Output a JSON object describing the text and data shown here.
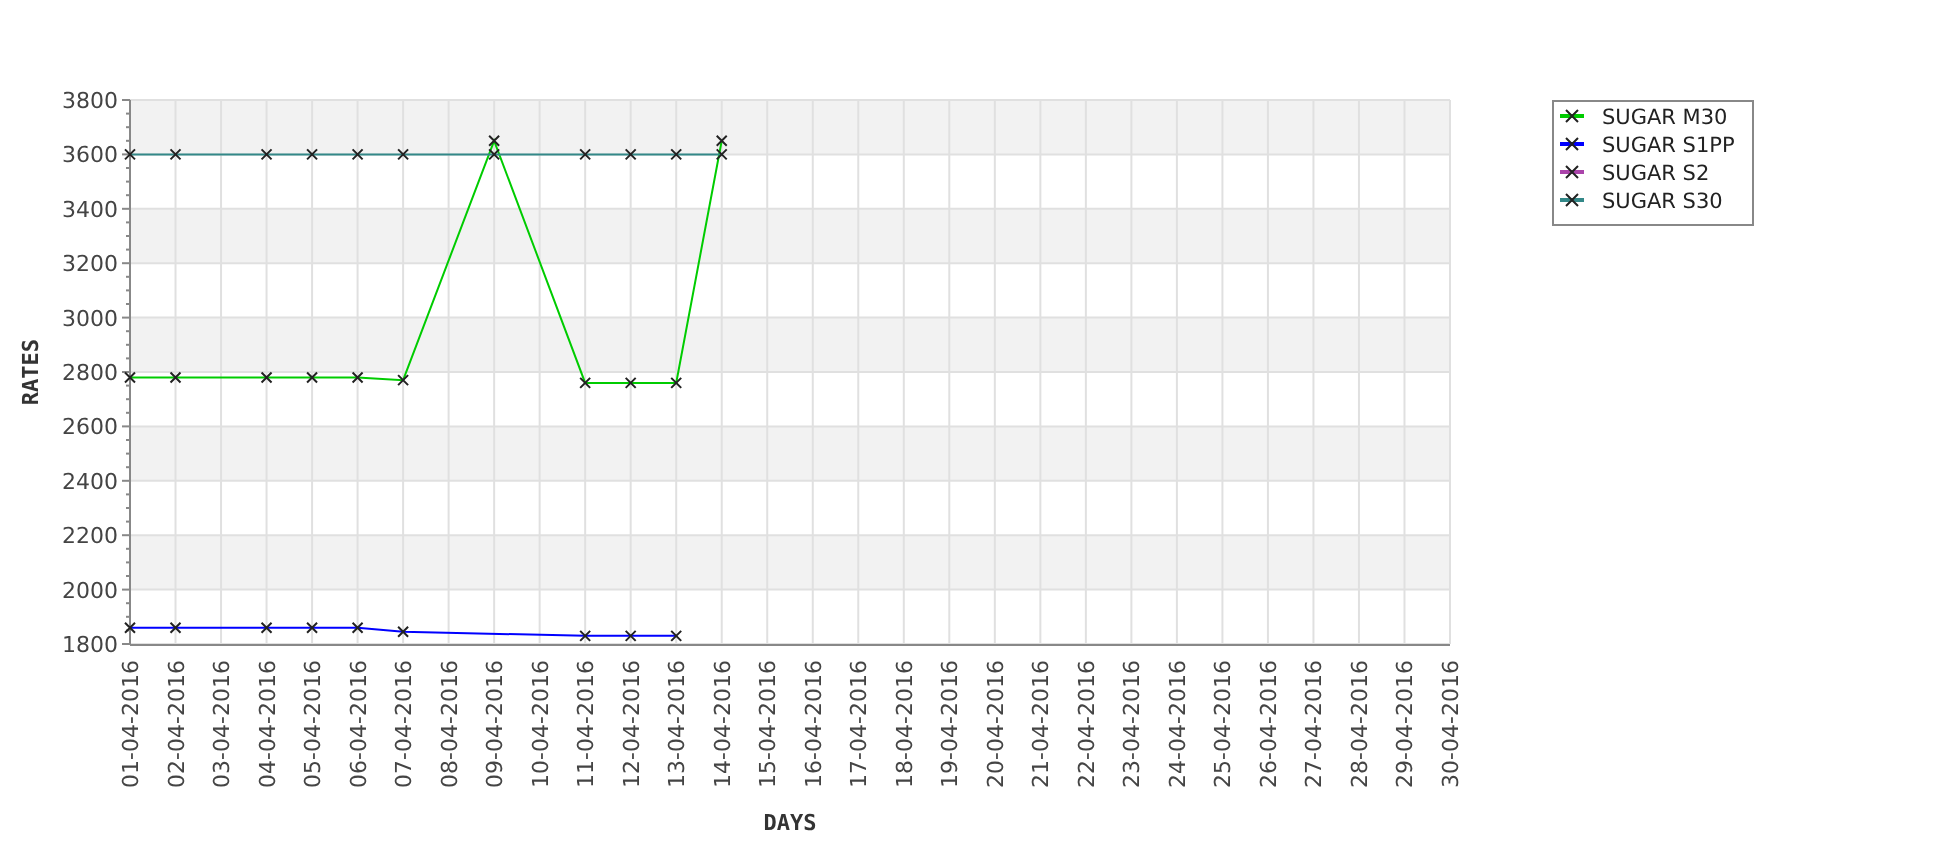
{
  "chart_data": {
    "type": "line",
    "xlabel": "DAYS",
    "ylabel": "RATES",
    "categories": [
      "01-04-2016",
      "02-04-2016",
      "03-04-2016",
      "04-04-2016",
      "05-04-2016",
      "06-04-2016",
      "07-04-2016",
      "08-04-2016",
      "09-04-2016",
      "10-04-2016",
      "11-04-2016",
      "12-04-2016",
      "13-04-2016",
      "14-04-2016",
      "15-04-2016",
      "16-04-2016",
      "17-04-2016",
      "18-04-2016",
      "19-04-2016",
      "20-04-2016",
      "21-04-2016",
      "22-04-2016",
      "23-04-2016",
      "24-04-2016",
      "25-04-2016",
      "26-04-2016",
      "27-04-2016",
      "28-04-2016",
      "29-04-2016",
      "30-04-2016"
    ],
    "ylim": [
      1800,
      3800
    ],
    "grid": true,
    "legend": true,
    "yticks": [
      1800,
      2000,
      2200,
      2400,
      2600,
      2800,
      3000,
      3200,
      3400,
      3600,
      3800
    ],
    "series": [
      {
        "name": "SUGAR M30",
        "color": "#00cc00",
        "marker": "x",
        "values": [
          2780,
          2780,
          null,
          2780,
          2780,
          2780,
          2770,
          null,
          3650,
          null,
          2760,
          2760,
          2760,
          3650,
          null,
          null,
          null,
          null,
          null,
          null,
          null,
          null,
          null,
          null,
          null,
          null,
          null,
          null,
          null,
          null
        ]
      },
      {
        "name": "SUGAR S1PP",
        "color": "#0000ff",
        "marker": "x",
        "values": [
          1860,
          1860,
          null,
          1860,
          1860,
          1860,
          1845,
          null,
          null,
          null,
          1830,
          1830,
          1830,
          null,
          null,
          null,
          null,
          null,
          null,
          null,
          null,
          null,
          null,
          null,
          null,
          null,
          null,
          null,
          null,
          null
        ]
      },
      {
        "name": "SUGAR S2",
        "color": "#aa44aa",
        "marker": "x",
        "values": [
          null,
          null,
          null,
          null,
          null,
          null,
          null,
          null,
          null,
          null,
          null,
          null,
          null,
          null,
          null,
          null,
          null,
          null,
          null,
          null,
          null,
          null,
          null,
          null,
          null,
          null,
          null,
          null,
          null,
          null
        ]
      },
      {
        "name": "SUGAR S30",
        "color": "#338888",
        "marker": "x",
        "values": [
          3600,
          3600,
          null,
          3600,
          3600,
          3600,
          3600,
          null,
          3600,
          null,
          3600,
          3600,
          3600,
          3600,
          null,
          null,
          null,
          null,
          null,
          null,
          null,
          null,
          null,
          null,
          null,
          null,
          null,
          null,
          null,
          null
        ]
      }
    ]
  }
}
